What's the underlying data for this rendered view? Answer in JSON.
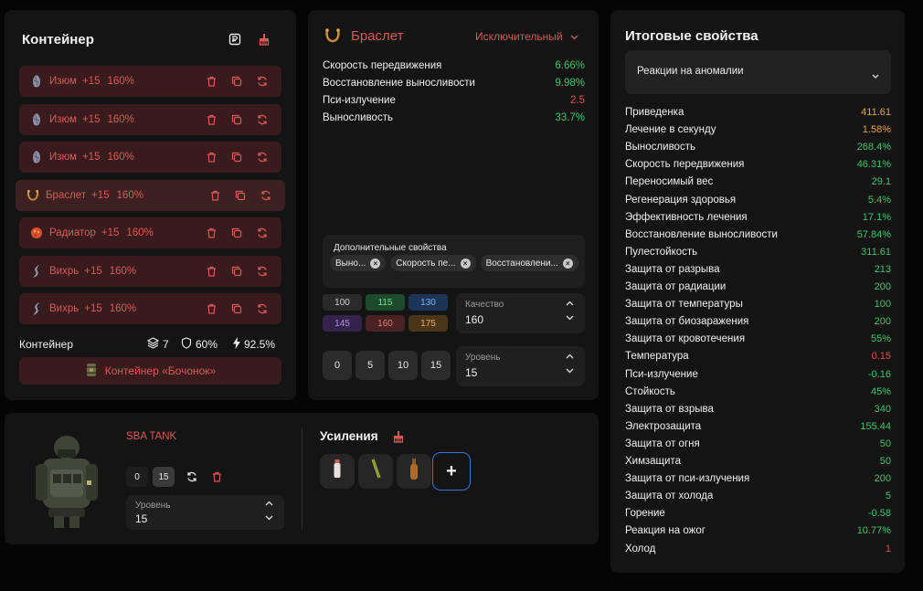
{
  "container": {
    "title": "Контейнер",
    "items": [
      {
        "name": "Изюм",
        "level": "+15",
        "quality": "160%",
        "icon": "raisin-artifact-icon"
      },
      {
        "name": "Изюм",
        "level": "+15",
        "quality": "160%",
        "icon": "raisin-artifact-icon"
      },
      {
        "name": "Изюм",
        "level": "+15",
        "quality": "160%",
        "icon": "raisin-artifact-icon"
      },
      {
        "name": "Браслет",
        "level": "+15",
        "quality": "160%",
        "icon": "bracelet-artifact-icon"
      },
      {
        "name": "Радиатор",
        "level": "+15",
        "quality": "160%",
        "icon": "radiator-artifact-icon"
      },
      {
        "name": "Вихрь",
        "level": "+15",
        "quality": "160%",
        "icon": "whirl-artifact-icon"
      },
      {
        "name": "Вихрь",
        "level": "+15",
        "quality": "160%",
        "icon": "whirl-artifact-icon"
      }
    ],
    "footer_label": "Контейнер",
    "slots": "7",
    "protection": "60%",
    "efficiency": "92.5%",
    "container_button": "Контейнер «Бочонок»"
  },
  "artifact": {
    "name": "Браслет",
    "rarity": "Исключительный",
    "properties": [
      {
        "name": "Скорость передвижения",
        "value": "6.66%",
        "color": "#3cc46a"
      },
      {
        "name": "Восстановление выносливости",
        "value": "9.98%",
        "color": "#3cc46a"
      },
      {
        "name": "Пси-излучение",
        "value": "2.5",
        "color": "#d8524c"
      },
      {
        "name": "Выносливость",
        "value": "33.7%",
        "color": "#3cc46a"
      }
    ],
    "extra_title": "Дополнительные свойства",
    "extra_chips": [
      "Выно...",
      "Скорость пе...",
      "Восстановлени..."
    ],
    "quality_options": [
      {
        "label": "100",
        "bg": "#2a2a2a",
        "fg": "#cfcfcf"
      },
      {
        "label": "115",
        "bg": "#1d4a2a",
        "fg": "#7fd896"
      },
      {
        "label": "130",
        "bg": "#1c3556",
        "fg": "#7fb2ef"
      },
      {
        "label": "145",
        "bg": "#33234a",
        "fg": "#b38fe2"
      },
      {
        "label": "160",
        "bg": "#4a2223",
        "fg": "#e27c7a"
      },
      {
        "label": "175",
        "bg": "#4a3519",
        "fg": "#e8b060"
      }
    ],
    "quality_label": "Качество",
    "quality_value": "160",
    "level_buttons": [
      "0",
      "5",
      "10",
      "15"
    ],
    "level_label": "Уровень",
    "level_value": "15"
  },
  "armor": {
    "name": "SBA TANK",
    "level_buttons": [
      "0",
      "15"
    ],
    "level_label": "Уровень",
    "level_value": "15",
    "boosts_title": "Усиления",
    "add_label": "+"
  },
  "totals": {
    "title": "Итоговые свойства",
    "filter": "Реакции на аномалии",
    "rows": [
      {
        "name": "Приведенка",
        "value": "411.61",
        "color": "#e8a24a"
      },
      {
        "name": "Лечение в секунду",
        "value": "1.58%",
        "color": "#e8a24a"
      },
      {
        "name": "Выносливость",
        "value": "268.4%",
        "color": "#3cc46a"
      },
      {
        "name": "Скорость передвижения",
        "value": "46.31%",
        "color": "#3cc46a"
      },
      {
        "name": "Переносимый вес",
        "value": "29.1",
        "color": "#3cc46a"
      },
      {
        "name": "Регенерация здоровья",
        "value": "5.4%",
        "color": "#3cc46a"
      },
      {
        "name": "Эффективность лечения",
        "value": "17.1%",
        "color": "#3cc46a"
      },
      {
        "name": "Восстановление выносливости",
        "value": "57.84%",
        "color": "#3cc46a"
      },
      {
        "name": "Пулестойкость",
        "value": "311.61",
        "color": "#3cc46a"
      },
      {
        "name": "Защита от разрыва",
        "value": "213",
        "color": "#3cc46a"
      },
      {
        "name": "Защита от радиации",
        "value": "200",
        "color": "#3cc46a"
      },
      {
        "name": "Защита от температуры",
        "value": "100",
        "color": "#3cc46a"
      },
      {
        "name": "Защита от биозаражения",
        "value": "200",
        "color": "#3cc46a"
      },
      {
        "name": "Защита от кровотечения",
        "value": "55%",
        "color": "#3cc46a"
      },
      {
        "name": "Температура",
        "value": "0.15",
        "color": "#d8524c"
      },
      {
        "name": "Пси-излучение",
        "value": "-0.16",
        "color": "#3cc46a"
      },
      {
        "name": "Стойкость",
        "value": "45%",
        "color": "#3cc46a"
      },
      {
        "name": "Защита от взрыва",
        "value": "340",
        "color": "#3cc46a"
      },
      {
        "name": "Электрозащита",
        "value": "155.44",
        "color": "#3cc46a"
      },
      {
        "name": "Защита от огня",
        "value": "50",
        "color": "#3cc46a"
      },
      {
        "name": "Химзащита",
        "value": "50",
        "color": "#3cc46a"
      },
      {
        "name": "Защита от пси-излучения",
        "value": "200",
        "color": "#3cc46a"
      },
      {
        "name": "Защита от холода",
        "value": "5",
        "color": "#3cc46a"
      },
      {
        "name": "Горение",
        "value": "-0.58",
        "color": "#3cc46a"
      },
      {
        "name": "Реакция на ожог",
        "value": "10.77%",
        "color": "#3cc46a"
      },
      {
        "name": "Холод",
        "value": "1",
        "color": "#d8524c"
      }
    ]
  }
}
